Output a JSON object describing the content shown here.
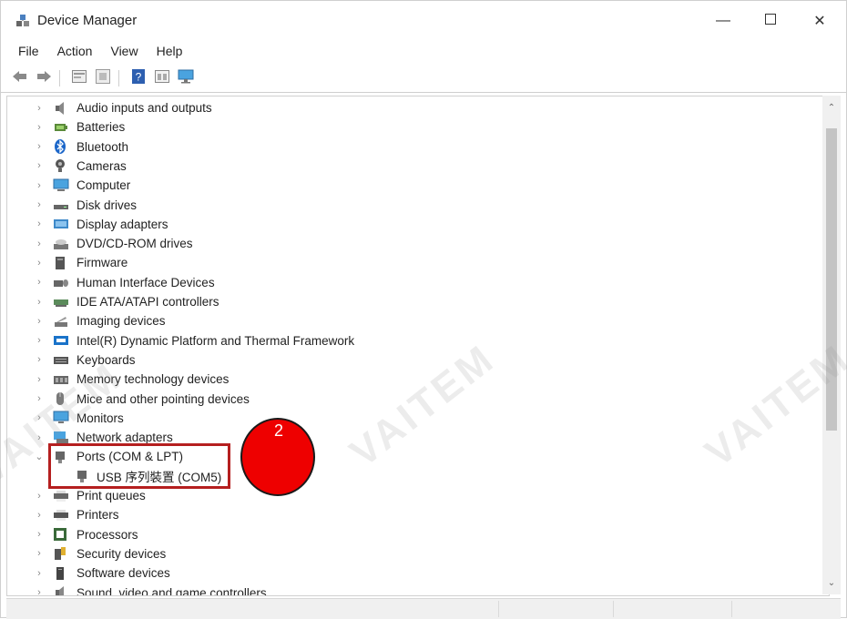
{
  "window": {
    "title": "Device Manager"
  },
  "menubar": [
    {
      "label": "File"
    },
    {
      "label": "Action"
    },
    {
      "label": "View"
    },
    {
      "label": "Help"
    }
  ],
  "toolbar": {
    "buttons": [
      "back-icon",
      "forward-icon",
      "properties-icon",
      "update-driver-icon",
      "help-icon",
      "view-icon",
      "monitor-scan-icon"
    ]
  },
  "tree": {
    "items": [
      {
        "label": "Audio inputs and outputs",
        "icon": "speaker-icon",
        "expanded": false
      },
      {
        "label": "Batteries",
        "icon": "battery-icon",
        "expanded": false
      },
      {
        "label": "Bluetooth",
        "icon": "bluetooth-icon",
        "expanded": false
      },
      {
        "label": "Cameras",
        "icon": "camera-icon",
        "expanded": false
      },
      {
        "label": "Computer",
        "icon": "computer-icon",
        "expanded": false
      },
      {
        "label": "Disk drives",
        "icon": "disk-icon",
        "expanded": false
      },
      {
        "label": "Display adapters",
        "icon": "display-adapter-icon",
        "expanded": false
      },
      {
        "label": "DVD/CD-ROM drives",
        "icon": "dvd-icon",
        "expanded": false
      },
      {
        "label": "Firmware",
        "icon": "firmware-icon",
        "expanded": false
      },
      {
        "label": "Human Interface Devices",
        "icon": "hid-icon",
        "expanded": false
      },
      {
        "label": "IDE ATA/ATAPI controllers",
        "icon": "ide-icon",
        "expanded": false
      },
      {
        "label": "Imaging devices",
        "icon": "imaging-icon",
        "expanded": false
      },
      {
        "label": "Intel(R) Dynamic Platform and Thermal Framework",
        "icon": "intel-icon",
        "expanded": false
      },
      {
        "label": "Keyboards",
        "icon": "keyboard-icon",
        "expanded": false
      },
      {
        "label": "Memory technology devices",
        "icon": "memory-icon",
        "expanded": false
      },
      {
        "label": "Mice and other pointing devices",
        "icon": "mouse-icon",
        "expanded": false
      },
      {
        "label": "Monitors",
        "icon": "monitor-icon",
        "expanded": false
      },
      {
        "label": "Network adapters",
        "icon": "network-icon",
        "expanded": false
      },
      {
        "label": "Ports (COM & LPT)",
        "icon": "port-icon",
        "expanded": true
      },
      {
        "label": "USB 序列裝置 (COM5)",
        "icon": "port-icon",
        "child": true
      },
      {
        "label": "Print queues",
        "icon": "print-queue-icon",
        "expanded": false
      },
      {
        "label": "Printers",
        "icon": "printer-icon",
        "expanded": false
      },
      {
        "label": "Processors",
        "icon": "processor-icon",
        "expanded": false
      },
      {
        "label": "Security devices",
        "icon": "security-icon",
        "expanded": false
      },
      {
        "label": "Software devices",
        "icon": "software-device-icon",
        "expanded": false
      },
      {
        "label": "Sound, video and game controllers",
        "icon": "sound-icon",
        "expanded": false
      }
    ]
  },
  "annotation": {
    "step_number": "2",
    "badge_color": "#ee0000",
    "highlight_color": "#b51f1f"
  },
  "watermark": {
    "text": "VAITEM"
  }
}
